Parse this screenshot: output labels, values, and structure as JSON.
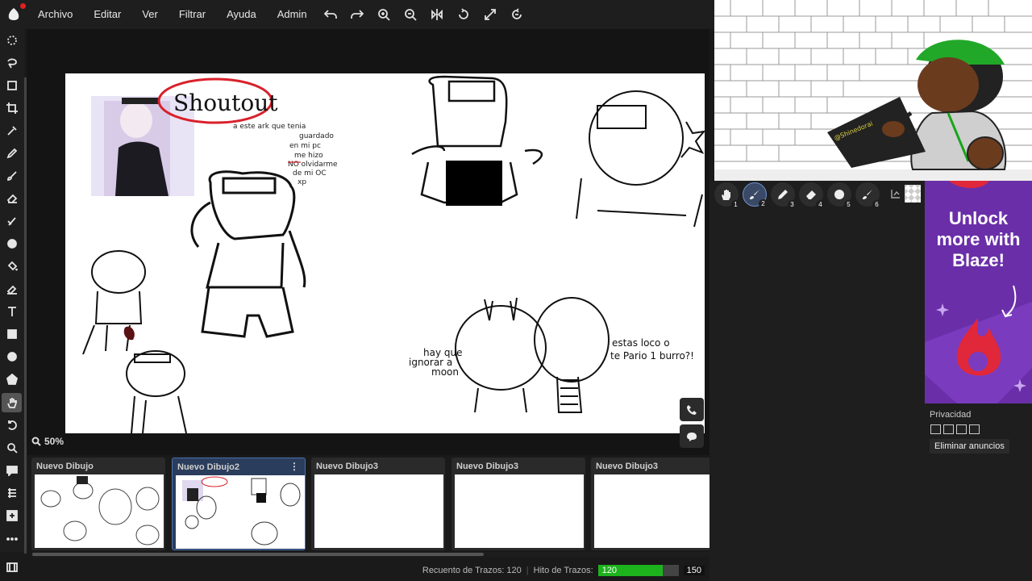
{
  "menu": {
    "items": [
      "Archivo",
      "Editar",
      "Ver",
      "Filtrar",
      "Ayuda",
      "Admin"
    ]
  },
  "top_tools": [
    "undo-icon",
    "redo-icon",
    "zoom-in-icon",
    "zoom-out-icon",
    "flip-icon",
    "rotate-icon",
    "fullscreen-icon",
    "reset-view-icon"
  ],
  "left_tools": [
    "select-ellipse-icon",
    "lasso-icon",
    "transform-icon",
    "crop-icon",
    "eyedropper-icon",
    "pencil-icon",
    "brush-icon",
    "eraser-icon",
    "smudge-icon",
    "blur-icon",
    "fill-icon",
    "ink-icon",
    "text-icon",
    "rectangle-icon",
    "circle-icon",
    "shape-icon",
    "hand-icon",
    "undo-icon",
    "zoom-icon",
    "chat-icon",
    "layers-icon",
    "add-icon",
    "more-icon"
  ],
  "canvas": {
    "zoom_label": "50%",
    "drawn_text": {
      "shoutout": "Shoutout",
      "note_lines": [
        "a este ark que tenia",
        "guardado",
        "en mi pc",
        "me hizo",
        "NO olvidarme",
        "de mi OC",
        "xp"
      ],
      "hay_que": [
        "hay que",
        "ignorar a",
        "moon"
      ],
      "estas_loco": [
        "estas loco o",
        "te Pario 1 burro?!"
      ]
    }
  },
  "thumbnails": [
    {
      "label": "Nuevo Dibujo",
      "selected": false
    },
    {
      "label": "Nuevo Dibujo2",
      "selected": true
    },
    {
      "label": "Nuevo Dibujo3",
      "selected": false
    },
    {
      "label": "Nuevo Dibujo3",
      "selected": false
    },
    {
      "label": "Nuevo Dibujo3",
      "selected": false
    }
  ],
  "status": {
    "stroke_count_label": "Recuento de Trazos: 120",
    "stroke_limit_label": "Hito de Trazos:",
    "progress_value": "120",
    "progress_max": "150",
    "progress_fraction": 0.8
  },
  "brushes": [
    {
      "icon": "hand-icon",
      "num": "1"
    },
    {
      "icon": "brush-icon",
      "num": "2"
    },
    {
      "icon": "pen-icon",
      "num": "3"
    },
    {
      "icon": "eraser-icon",
      "num": "4"
    },
    {
      "icon": "dot-icon",
      "num": "5"
    },
    {
      "icon": "brush-icon",
      "num": "6"
    }
  ],
  "ad": {
    "text": "Unlock more with Blaze!",
    "bg_color": "#6a2fa8"
  },
  "privacy": {
    "label": "Privacidad",
    "remove_ads": "Eliminar anuncios"
  }
}
